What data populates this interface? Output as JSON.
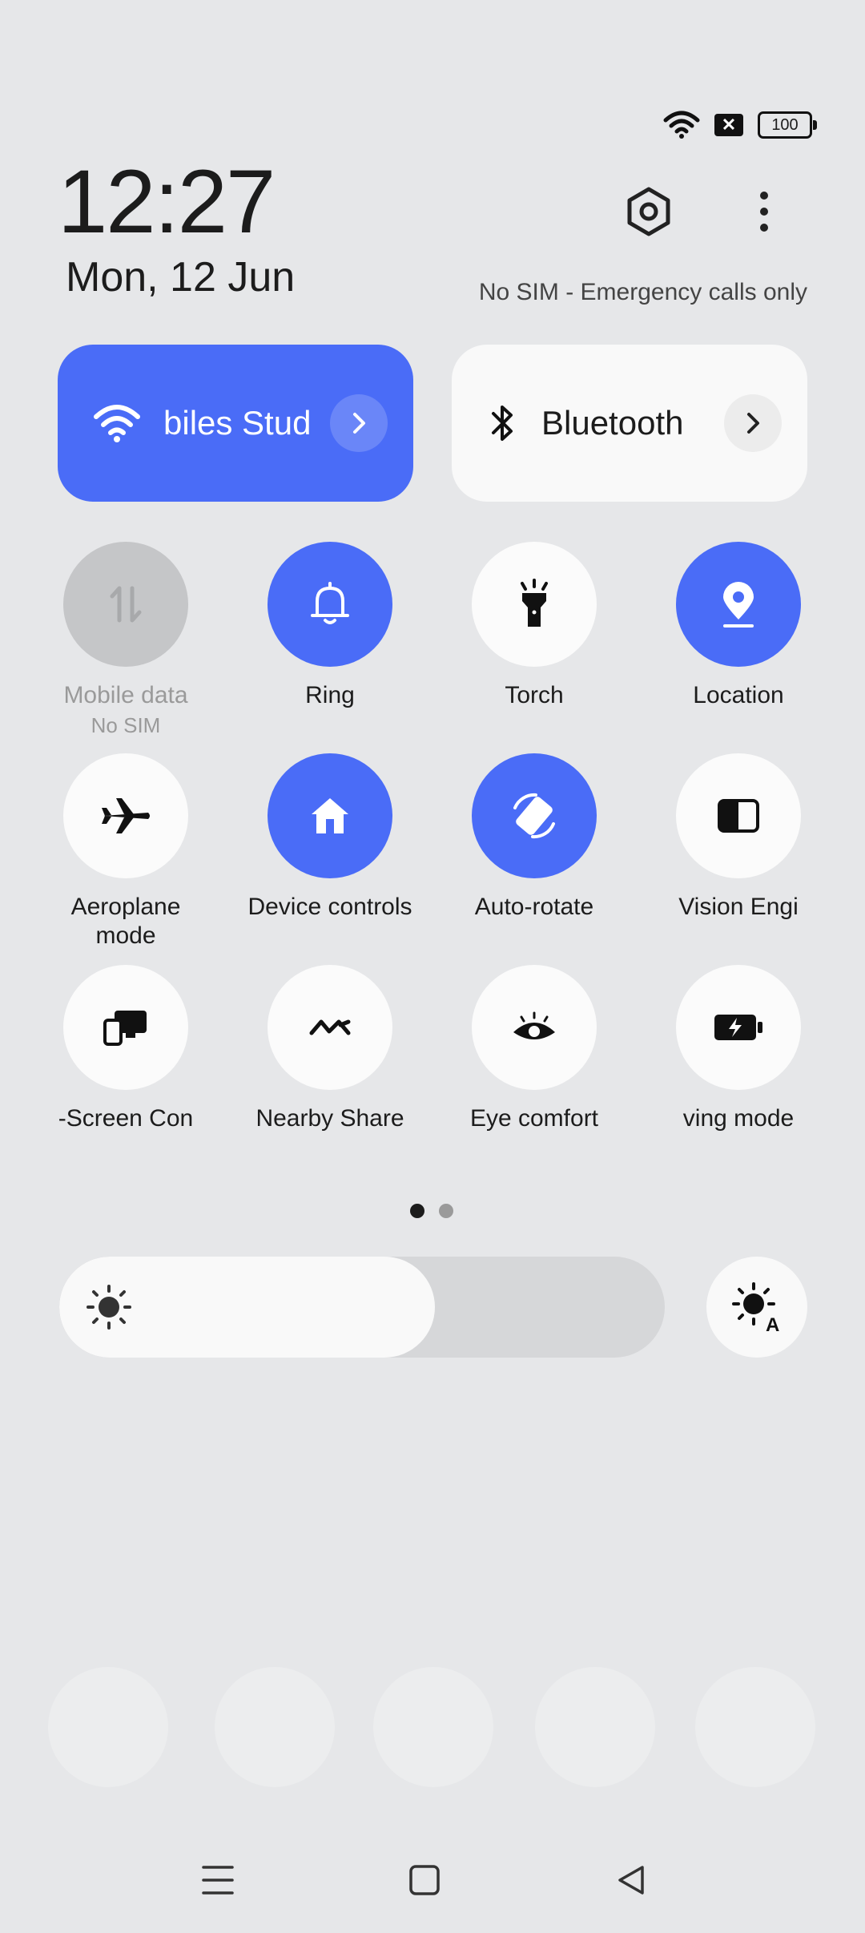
{
  "status_bar": {
    "battery_level": "100",
    "sim_icon": "sim-missing-icon",
    "wifi_icon": "wifi-icon"
  },
  "header": {
    "time": "12:27",
    "date": "Mon, 12 Jun",
    "sim_status": "No SIM - Emergency calls only"
  },
  "big_tiles": {
    "wifi": {
      "label": "biles Stud",
      "icon": "wifi-icon"
    },
    "bluetooth": {
      "label": "Bluetooth",
      "icon": "bluetooth-icon"
    }
  },
  "tiles": {
    "mobile_data": {
      "label": "Mobile data",
      "sub": "No SIM"
    },
    "ring": {
      "label": "Ring"
    },
    "torch": {
      "label": "Torch"
    },
    "location": {
      "label": "Location"
    },
    "aeroplane": {
      "label": "Aeroplane mode"
    },
    "device_controls": {
      "label": "Device controls"
    },
    "auto_rotate": {
      "label": "Auto-rotate"
    },
    "vision_engine": {
      "label": "Vision Engi"
    },
    "screen_cast": {
      "label": "-Screen Con"
    },
    "nearby_share": {
      "label": "Nearby Share"
    },
    "eye_comfort": {
      "label": "Eye comfort"
    },
    "saving_mode": {
      "label": "ving mode"
    }
  },
  "pager": {
    "pages": 2,
    "current": 1
  },
  "brightness": {
    "level_percent": 62
  },
  "colors": {
    "accent": "#4a6cf7",
    "tile_bg": "#fbfbfb",
    "disabled": "#c5c6c8"
  }
}
